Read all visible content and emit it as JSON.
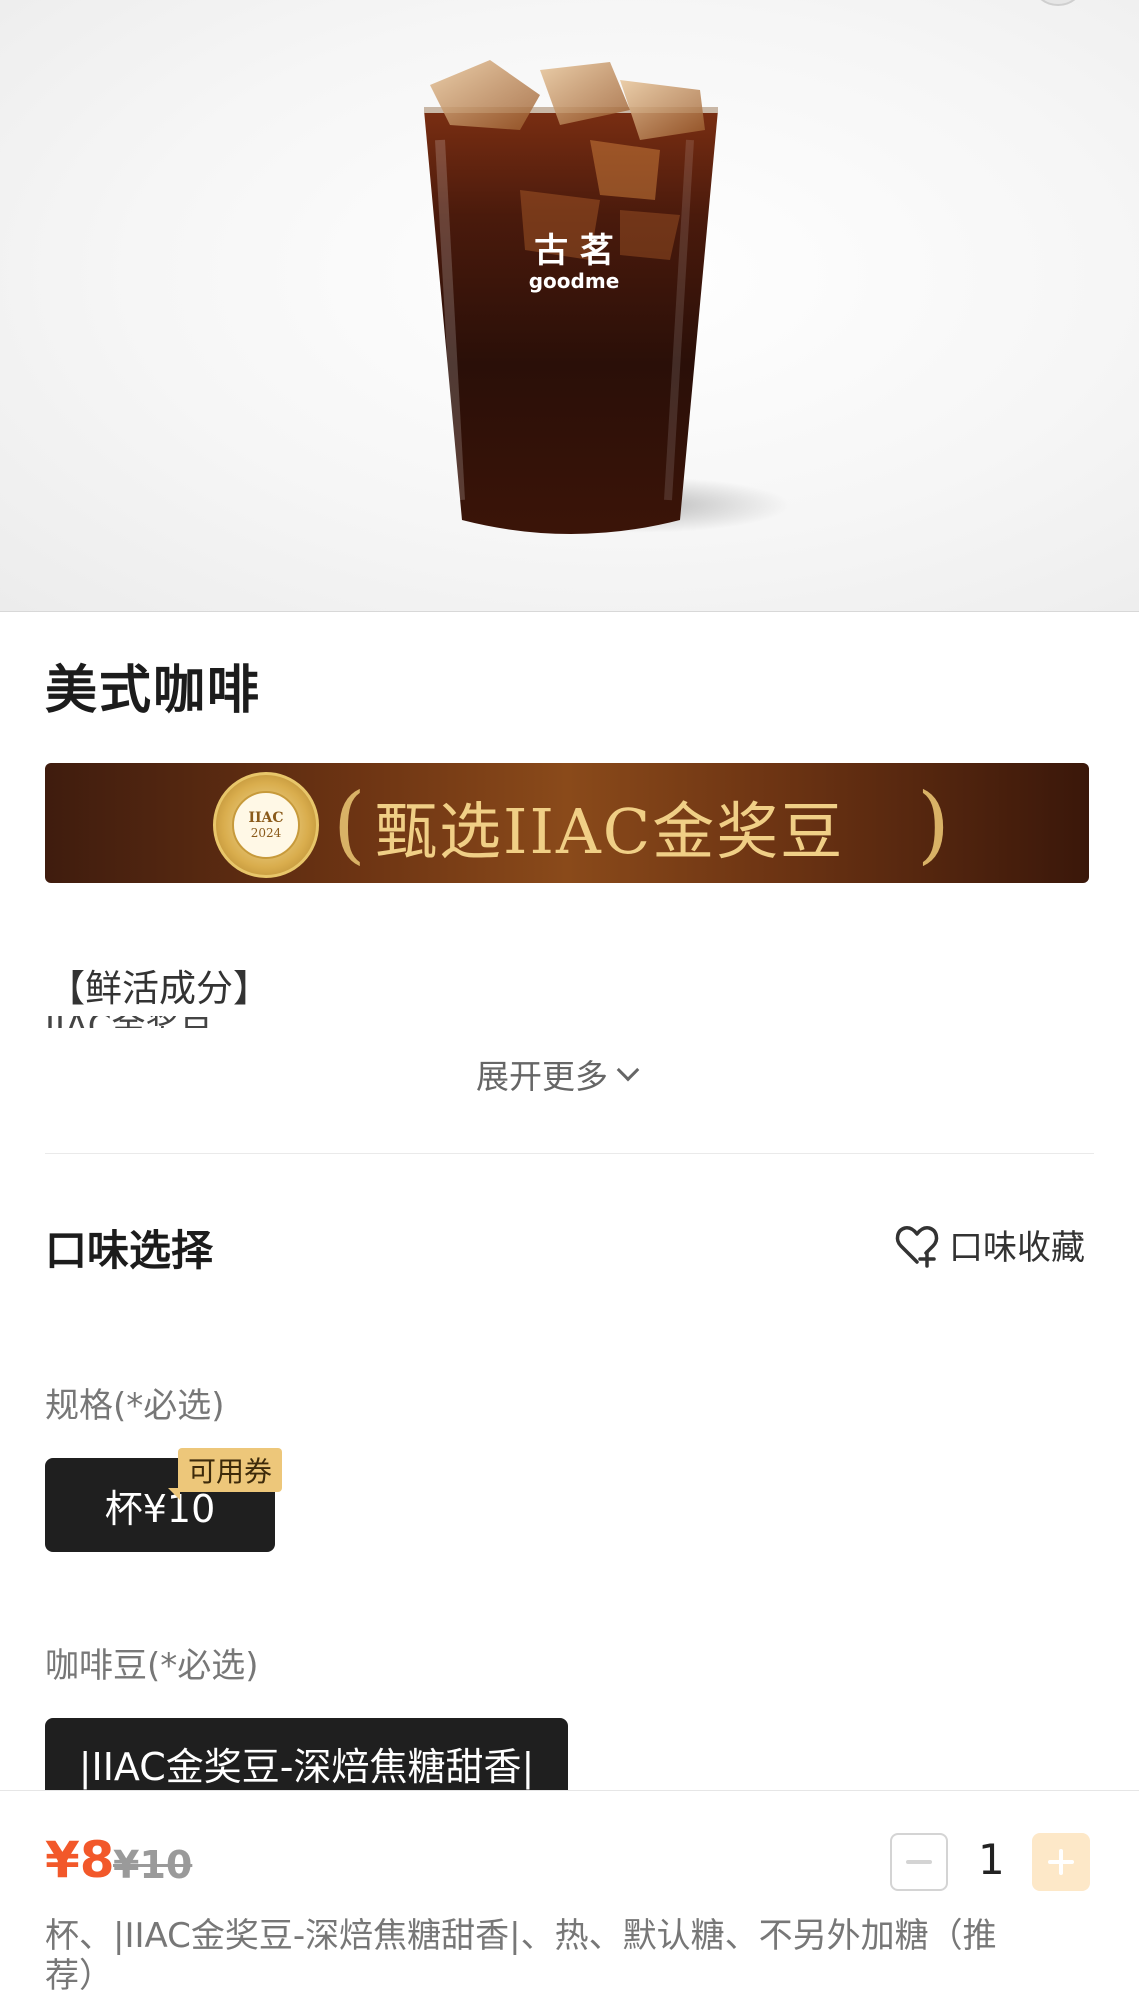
{
  "product": {
    "title": "美式咖啡",
    "cup_brand_cn": "古 茗",
    "cup_brand_en": "goodme",
    "banner_text": "甄选IIAC金奖豆",
    "medal_top": "IIAC",
    "medal_year": "2024"
  },
  "description": {
    "heading": "【鲜活成分】",
    "truncated_line": "IIAC金奖豆",
    "expand_label": "展开更多"
  },
  "taste": {
    "title": "口味选择",
    "favorite_label": "口味收藏",
    "spec": {
      "label": "规格(*必选)",
      "option": "杯¥10",
      "coupon_badge": "可用券"
    },
    "beans": {
      "label": "咖啡豆(*必选)",
      "option": "|IIAC金奖豆-深焙焦糖甜香|"
    }
  },
  "bottom_bar": {
    "price": "¥8",
    "original_price": "¥10",
    "quantity": "1",
    "summary": "杯、|IIAC金奖豆-深焙焦糖甜香|、热、默认糖、不另外加糖（推荐）"
  },
  "colors": {
    "accent_price": "#f2582a",
    "coupon_bg": "#edc77a",
    "option_bg": "#1f1f1f",
    "plus_button_bg": "#fde8c8"
  }
}
